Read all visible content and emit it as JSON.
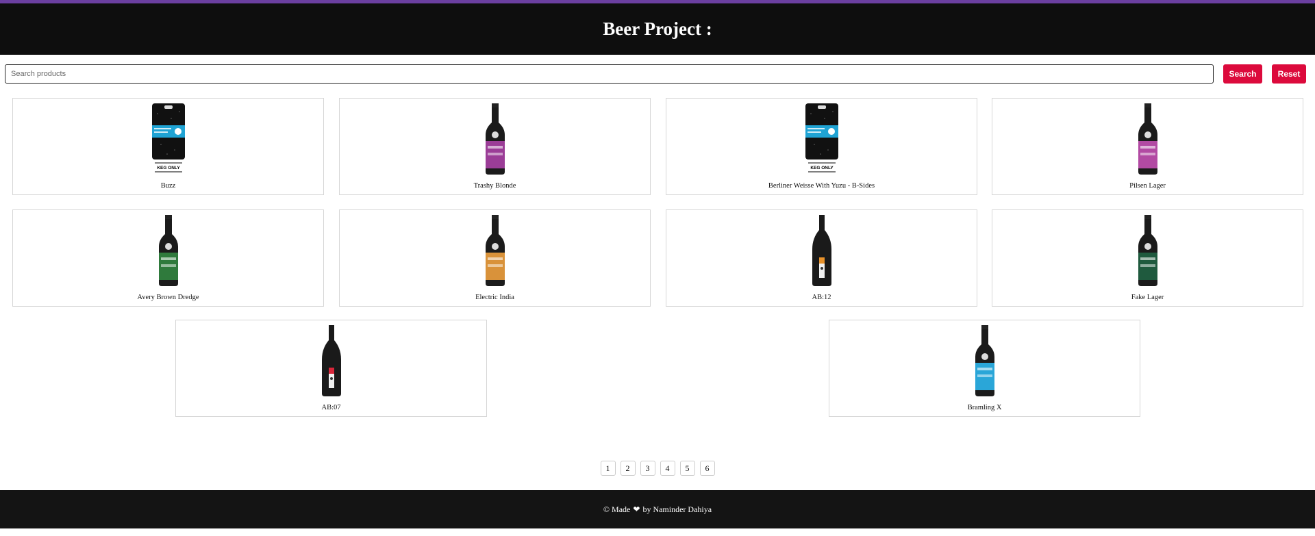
{
  "colors": {
    "accent_top": "#6b3fa0",
    "header_bg": "#0e0e0e",
    "button_red": "#dc0a3c",
    "footer_bg": "#141414"
  },
  "header": {
    "title": "Beer Project :"
  },
  "search": {
    "placeholder": "Search products",
    "value": "",
    "search_label": "Search",
    "reset_label": "Reset"
  },
  "products": [
    {
      "name": "Buzz",
      "image": "keg-icon",
      "label_color": "#1fa3d4",
      "keg_text": "KEG ONLY"
    },
    {
      "name": "Trashy Blonde",
      "image": "bottle-icon",
      "label_color": "#9b3d97"
    },
    {
      "name": "Berliner Weisse With Yuzu - B-Sides",
      "image": "keg-icon",
      "label_color": "#1fa3d4",
      "keg_text": "KEG ONLY"
    },
    {
      "name": "Pilsen Lager",
      "image": "bottle-icon",
      "label_color": "#b24aa3"
    },
    {
      "name": "Avery Brown Dredge",
      "image": "bottle-icon",
      "label_color": "#2f7a3c"
    },
    {
      "name": "Electric India",
      "image": "bottle-icon",
      "label_color": "#d9923a"
    },
    {
      "name": "AB:12",
      "image": "tall-bottle-icon",
      "label_color": "#e8922b"
    },
    {
      "name": "Fake Lager",
      "image": "bottle-icon",
      "label_color": "#1f5a3e"
    },
    {
      "name": "AB:07",
      "image": "tall-bottle-icon",
      "label_color": "#d9263a"
    },
    {
      "name": "Bramling X",
      "image": "bottle-icon",
      "label_color": "#2aa6d8"
    }
  ],
  "pagination": [
    "1",
    "2",
    "3",
    "4",
    "5",
    "6"
  ],
  "footer": {
    "prefix": "© Made",
    "heart": "❤",
    "suffix": "by Naminder Dahiya"
  }
}
